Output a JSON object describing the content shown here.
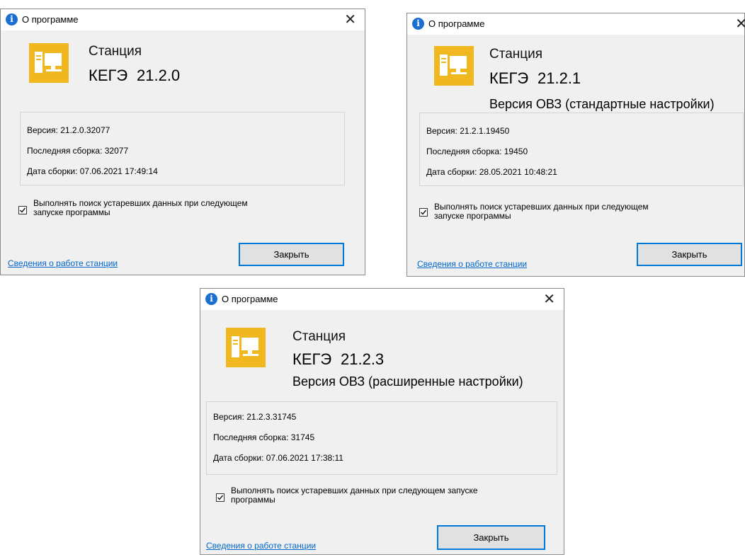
{
  "dialogs": [
    {
      "title": "О программе",
      "close_glyph": "✕",
      "app_name": "Станция",
      "product": "КЕГЭ",
      "version_short": "21.2.0",
      "edition": "",
      "version_label": "Версия: 21.2.0.32077",
      "build_label": "Последняя сборка: 32077",
      "date_label": "Дата сборки: 07.06.2021 17:49:14",
      "checkbox_checked": true,
      "checkbox_line1": "Выполнять поиск устаревших данных при следующем",
      "checkbox_line2": "запуске программы",
      "link_text": "Сведения о работе станции",
      "button_text": "Закрыть"
    },
    {
      "title": "О программе",
      "close_glyph": "✕",
      "app_name": "Станция",
      "product": "КЕГЭ",
      "version_short": "21.2.1",
      "edition": "Версия ОВЗ (стандартные настройки)",
      "version_label": "Версия: 21.2.1.19450",
      "build_label": "Последняя сборка: 19450",
      "date_label": "Дата сборки: 28.05.2021 10:48:21",
      "checkbox_checked": true,
      "checkbox_line1": "Выполнять поиск устаревших данных при следующем",
      "checkbox_line2": "запуске программы",
      "link_text": "Сведения о работе станции",
      "button_text": "Закрыть"
    },
    {
      "title": "О программе",
      "close_glyph": "✕",
      "app_name": "Станция",
      "product": "КЕГЭ",
      "version_short": "21.2.3",
      "edition": "Версия ОВЗ (расширенные настройки)",
      "version_label": "Версия: 21.2.3.31745",
      "build_label": "Последняя сборка: 31745",
      "date_label": "Дата сборки: 07.06.2021 17:38:11",
      "checkbox_checked": true,
      "checkbox_line1": "Выполнять поиск устаревших данных при следующем запуске",
      "checkbox_line2": "программы",
      "link_text": "Сведения о работе станции",
      "button_text": "Закрыть"
    }
  ],
  "colors": {
    "accent": "#0078d7",
    "link": "#0066cc",
    "icon_bg": "#f0b81e",
    "dialog_bg": "#f0f0f0"
  }
}
